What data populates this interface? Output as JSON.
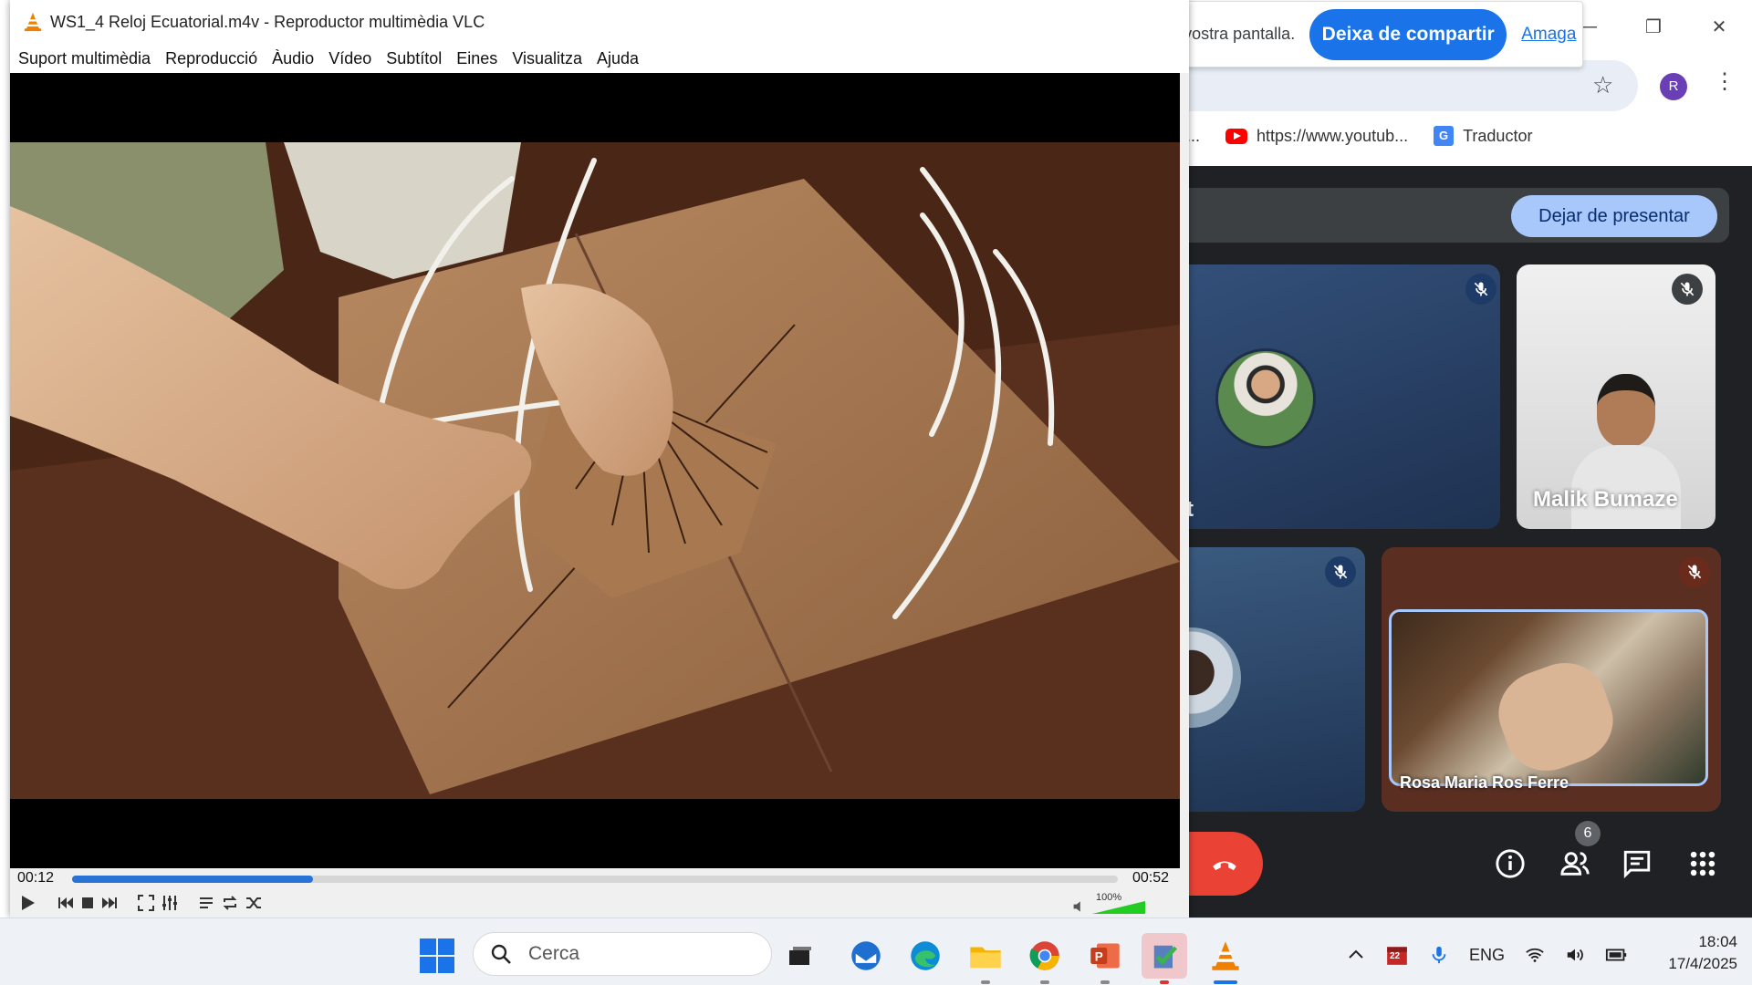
{
  "vlc": {
    "window_title": "WS1_4 Reloj Ecuatorial.m4v - Reproductor multimèdia VLC",
    "menu": [
      "Suport multimèdia",
      "Reproducció",
      "Àudio",
      "Vídeo",
      "Subtítol",
      "Eines",
      "Visualitza",
      "Ajuda"
    ],
    "time_elapsed": "00:12",
    "time_total": "00:52",
    "progress_fraction": 0.23,
    "volume_label": "100%",
    "volume_fraction": 1.0
  },
  "share_bar": {
    "message": "meet.google.com comparteix la vostra pantalla.",
    "stop_sharing_label": "Deixa de compartir",
    "hide_label": "Amaga"
  },
  "chrome": {
    "profile_initial": "R",
    "bookmarks": [
      {
        "label": "https://www.youtub...",
        "icon": "youtube-icon"
      },
      {
        "label": "Traductor",
        "icon": "google-translate-icon"
      }
    ],
    "bookmark_prefix": "..."
  },
  "meet": {
    "stop_presenting_label": "Dejar de presentar",
    "tiles": [
      {
        "name": "t",
        "muted": true
      },
      {
        "name": "Malik Bumaze",
        "muted": true
      },
      {
        "name": "",
        "muted": true
      },
      {
        "name": "Rosa Maria Ros Ferre",
        "muted": true
      }
    ],
    "participants_count": "6"
  },
  "taskbar": {
    "search_label": "Cerca",
    "apps": [
      "task-view",
      "thunderbird",
      "edge",
      "file-explorer",
      "chrome",
      "powerpoint",
      "clipboard-checker",
      "vlc"
    ],
    "language": "ENG",
    "calendar_badge": "22",
    "time": "18:04",
    "date": "17/4/2025"
  },
  "colors": {
    "vlc_progress": "#2a73d6",
    "meet_stop_presenting": "#a8c7fa",
    "share_button": "#1a73e8",
    "hangup": "#ea4335"
  }
}
